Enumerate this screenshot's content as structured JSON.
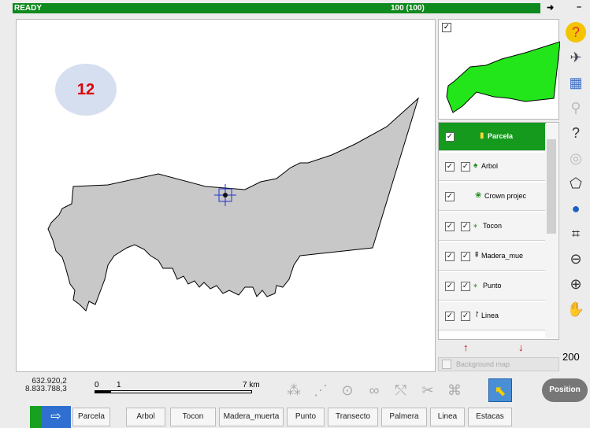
{
  "status": {
    "text": "READY",
    "count": "100 (100)",
    "arrow": "➜",
    "dash": "–"
  },
  "map": {
    "badge": "12"
  },
  "overview": {
    "checked": "✓"
  },
  "layers": [
    {
      "label": "Parcela",
      "selected": true,
      "icon": "▮"
    },
    {
      "label": "Arbol",
      "icon": "♠"
    },
    {
      "label": "Crown projec",
      "icon": "❀"
    },
    {
      "label": "Tocon",
      "icon": "⁎"
    },
    {
      "label": "Madera_mue",
      "icon": "⇞"
    },
    {
      "label": "Punto",
      "icon": "⁎"
    },
    {
      "label": "Linea",
      "icon": "↾"
    }
  ],
  "check": "✓",
  "background_map": "Background map",
  "coords": {
    "x": "632.920,2",
    "y": "8.833.788,3"
  },
  "scale": {
    "zero": "0",
    "one": "1",
    "end": "7 km",
    "display": "200"
  },
  "position_button": "Position",
  "tabs": [
    "Parcela",
    "Arbol",
    "Tocon",
    "Madera_muerta",
    "Punto",
    "Transecto",
    "Palmera",
    "Linea",
    "Estacas"
  ],
  "icons": {
    "help": "?",
    "satellite": "✈",
    "calendar": "▦",
    "pin": "⚲",
    "identify": "?",
    "layers": "◎",
    "polygon": "⬠",
    "globe": "●",
    "extent": "⌗",
    "zoom_out": "⊖",
    "zoom_in": "⊕",
    "pan": "✋",
    "home": "⇨",
    "select": "⬉"
  },
  "colors": {
    "status_green": "#0f8a1e",
    "parcel_fill": "#c8c8c8",
    "overview_fill": "#22e61a",
    "selected_layer": "#159a1e",
    "badge": "#d6dff0",
    "badge_text": "#dd0000"
  }
}
